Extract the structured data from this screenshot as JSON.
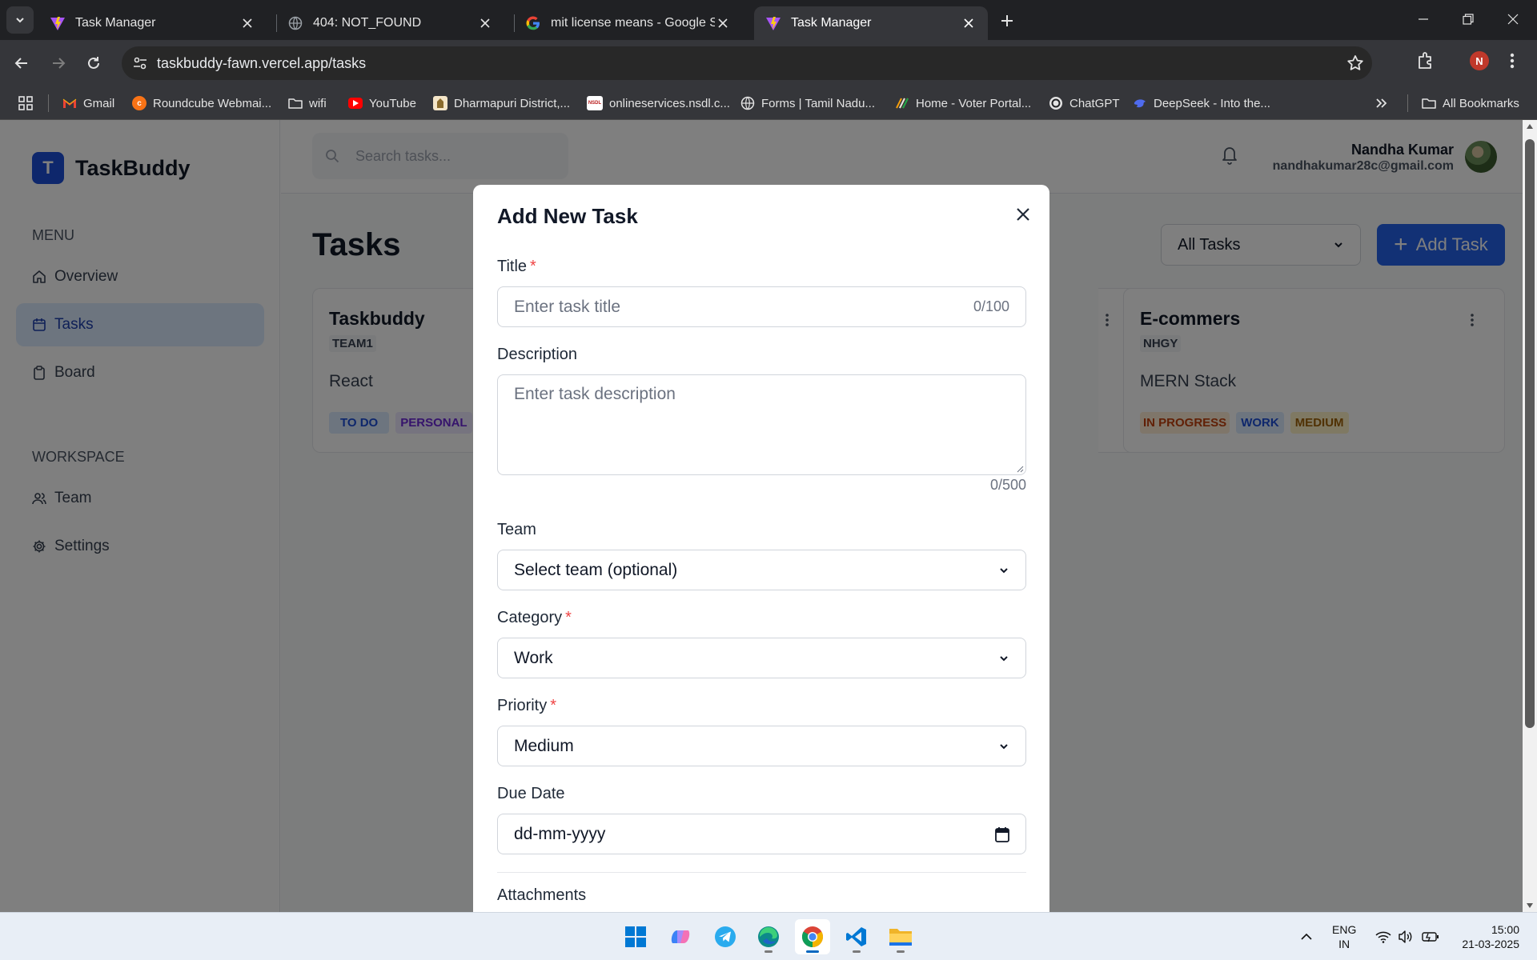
{
  "browser": {
    "tabs": [
      {
        "title": "Task Manager",
        "active": false
      },
      {
        "title": "404: NOT_FOUND",
        "active": false
      },
      {
        "title": "mit license means - Google Sea",
        "active": false
      },
      {
        "title": "Task Manager",
        "active": true
      }
    ],
    "url": "taskbuddy-fawn.vercel.app/tasks",
    "profile_initial": "N",
    "bookmarks": [
      {
        "label": "Gmail",
        "icon": "gmail-icon"
      },
      {
        "label": "Roundcube Webmai...",
        "icon": "roundcube-icon"
      },
      {
        "label": "wifi",
        "icon": "folder-icon"
      },
      {
        "label": "YouTube",
        "icon": "youtube-icon"
      },
      {
        "label": "Dharmapuri District,...",
        "icon": "emblem-icon"
      },
      {
        "label": "onlineservices.nsdl.c...",
        "icon": "nsdl-icon"
      },
      {
        "label": "Forms | Tamil Nadu...",
        "icon": "globe-icon"
      },
      {
        "label": "Home - Voter Portal...",
        "icon": "voter-icon"
      },
      {
        "label": "ChatGPT",
        "icon": "chatgpt-icon"
      },
      {
        "label": "DeepSeek - Into the...",
        "icon": "deepseek-icon"
      }
    ],
    "all_bookmarks": "All Bookmarks",
    "nsdl_favicon_text": "NSDL"
  },
  "app": {
    "logo_letter": "T",
    "name": "TaskBuddy",
    "menu_label": "MENU",
    "menu": [
      {
        "label": "Overview",
        "icon": "home-icon"
      },
      {
        "label": "Tasks",
        "icon": "calendar-icon",
        "active": true
      },
      {
        "label": "Board",
        "icon": "clipboard-icon"
      }
    ],
    "workspace_label": "WORKSPACE",
    "workspace": [
      {
        "label": "Team",
        "icon": "users-icon"
      },
      {
        "label": "Settings",
        "icon": "gear-icon"
      }
    ],
    "search_placeholder": "Search tasks...",
    "user": {
      "name": "Nandha Kumar",
      "email": "nandhakumar28c@gmail.com"
    },
    "page_title": "Tasks",
    "filter_value": "All Tasks",
    "add_task_label": "Add Task",
    "cards": [
      {
        "title": "Taskbuddy",
        "team": "TEAM1",
        "description": "React",
        "badges": [
          "TO DO",
          "PERSONAL"
        ]
      },
      {
        "title": "E-commers",
        "team": "NHGY",
        "description": "MERN Stack",
        "badges": [
          "IN PROGRESS",
          "WORK",
          "MEDIUM"
        ]
      }
    ]
  },
  "modal": {
    "title": "Add New Task",
    "title_label": "Title",
    "title_placeholder": "Enter task title",
    "title_counter": "0/100",
    "description_label": "Description",
    "description_placeholder": "Enter task description",
    "description_counter": "0/500",
    "team_label": "Team",
    "team_value": "Select team (optional)",
    "category_label": "Category",
    "category_value": "Work",
    "priority_label": "Priority",
    "priority_value": "Medium",
    "due_date_label": "Due Date",
    "due_date_placeholder": "dd-mm-yyyy",
    "attachments_label": "Attachments",
    "required_mark": "*"
  },
  "taskbar": {
    "lang_line1": "ENG",
    "lang_line2": "IN",
    "time": "15:00",
    "date": "21-03-2025"
  }
}
